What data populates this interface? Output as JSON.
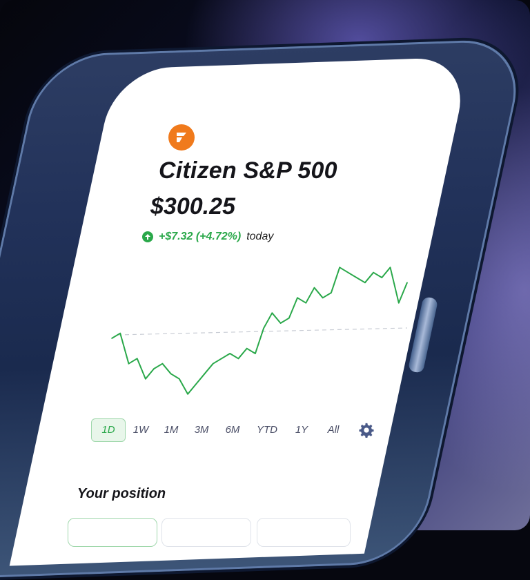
{
  "fund": {
    "name": "Citizen S&P 500",
    "price": "$300.25",
    "change": "+$7.32 (+4.72%)",
    "change_suffix": "today"
  },
  "time_ranges": [
    "1D",
    "1W",
    "1M",
    "3M",
    "6M",
    "YTD",
    "1Y",
    "All"
  ],
  "selected_range": "1D",
  "section": {
    "position_title": "Your position"
  },
  "colors": {
    "accent_green": "#2aa84a",
    "brand_orange": "#f07a1c",
    "text_dark": "#15151a"
  },
  "icons": {
    "logo": "citizen-logo-icon",
    "change": "arrow-up-circle-icon",
    "settings": "gear-icon"
  },
  "chart_data": {
    "type": "line",
    "x": [
      1,
      2,
      3,
      4,
      5,
      6,
      7,
      8,
      9,
      10,
      11,
      12,
      13,
      14,
      15,
      16,
      17,
      18,
      19,
      20,
      21,
      22,
      23,
      24,
      25,
      26,
      27,
      28,
      29,
      30,
      31,
      32,
      33,
      34,
      35,
      36
    ],
    "values": [
      100,
      101,
      95,
      96,
      92,
      94,
      95,
      93,
      92,
      89,
      91,
      93,
      95,
      96,
      97,
      96,
      98,
      97,
      102,
      105,
      103,
      104,
      108,
      107,
      110,
      108,
      109,
      114,
      113,
      112,
      111,
      113,
      112,
      114,
      107,
      111
    ],
    "baseline": 100,
    "series_color": "#2aa84a",
    "baseline_style": "dashed",
    "title": "",
    "xlabel": "",
    "ylabel": ""
  }
}
